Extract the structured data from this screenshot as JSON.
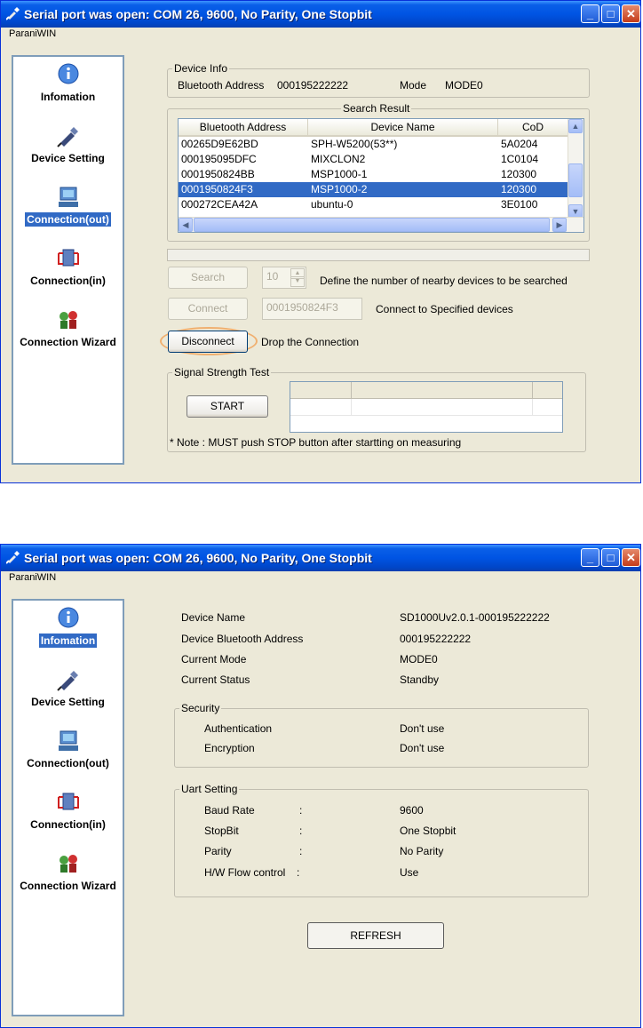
{
  "window1": {
    "title": "Serial port was open: COM 26, 9600, No Parity, One Stopbit",
    "menu": "ParaniWIN",
    "sidebar": [
      {
        "label": "Infomation"
      },
      {
        "label": "Device Setting"
      },
      {
        "label": "Connection(out)"
      },
      {
        "label": "Connection(in)"
      },
      {
        "label": "Connection Wizard"
      }
    ],
    "device_info": {
      "legend": "Device Info",
      "bt_label": "Bluetooth Address",
      "bt_value": "000195222222",
      "mode_label": "Mode",
      "mode_value": "MODE0"
    },
    "search_result": {
      "legend": "Search Result",
      "columns": [
        "Bluetooth Address",
        "Device Name",
        "CoD"
      ],
      "rows": [
        [
          "00265D9E62BD",
          "SPH-W5200(53**)",
          "5A0204"
        ],
        [
          "000195095DFC",
          "MIXCLON2",
          "1C0104"
        ],
        [
          "0001950824BB",
          "MSP1000-1",
          "120300"
        ],
        [
          "0001950824F3",
          "MSP1000-2",
          "120300"
        ],
        [
          "000272CEA42A",
          "ubuntu-0",
          "3E0100"
        ]
      ],
      "selected_row": 3
    },
    "search_button": "Search",
    "search_count": "10",
    "search_desc": "Define the number of nearby devices to be searched",
    "connect_button": "Connect",
    "connect_value": "0001950824F3",
    "connect_desc": "Connect to Specified devices",
    "disconnect_button": "Disconnect",
    "disconnect_desc": "Drop the Connection",
    "signal": {
      "legend": "Signal Strength Test",
      "start_button": "START",
      "note": "* Note : MUST push STOP button after startting on measuring"
    }
  },
  "window2": {
    "title": "Serial port was open: COM 26, 9600, No Parity, One Stopbit",
    "menu": "ParaniWIN",
    "sidebar": [
      {
        "label": "Infomation"
      },
      {
        "label": "Device Setting"
      },
      {
        "label": "Connection(out)"
      },
      {
        "label": "Connection(in)"
      },
      {
        "label": "Connection Wizard"
      }
    ],
    "info": [
      {
        "label": "Device Name",
        "value": "SD1000Uv2.0.1-000195222222"
      },
      {
        "label": "Device Bluetooth Address",
        "value": "000195222222"
      },
      {
        "label": "Current Mode",
        "value": "MODE0"
      },
      {
        "label": "Current Status",
        "value": "Standby"
      }
    ],
    "security": {
      "legend": "Security",
      "rows": [
        {
          "label": "Authentication",
          "value": "Don't use"
        },
        {
          "label": "Encryption",
          "value": "Don't use"
        }
      ]
    },
    "uart": {
      "legend": "Uart Setting",
      "colon": ":",
      "rows": [
        {
          "label": "Baud Rate",
          "value": "9600"
        },
        {
          "label": "StopBit",
          "value": "One Stopbit"
        },
        {
          "label": "Parity",
          "value": "No Parity"
        },
        {
          "label": "H/W Flow control",
          "value": "Use"
        }
      ]
    },
    "refresh_button": "REFRESH"
  }
}
